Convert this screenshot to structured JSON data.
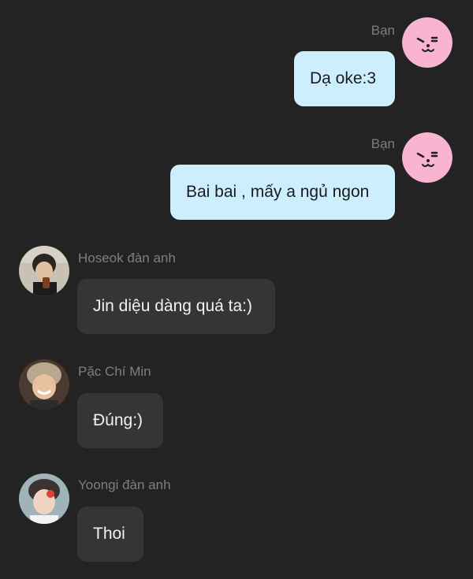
{
  "messages": [
    {
      "sender": "Bạn",
      "text": "Dạ oke:3",
      "avatar_icon": "bt21-pink-face-icon"
    },
    {
      "sender": "Bạn",
      "text": "Bai bai , mấy a ngủ ngon",
      "avatar_icon": "bt21-pink-face-icon"
    },
    {
      "sender": "Hoseok đàn anh",
      "text": "Jin diệu dàng quá ta:)",
      "avatar_icon": "person-photo-icon"
    },
    {
      "sender": "Pặc Chí Min",
      "text": "Đúng:)",
      "avatar_icon": "person-photo-icon"
    },
    {
      "sender": "Yoongi đàn anh",
      "text": "Thoi",
      "avatar_icon": "person-photo-icon"
    }
  ],
  "colors": {
    "background": "#232323",
    "my_bubble": "#cdeffd",
    "their_bubble": "#353535",
    "sender_name": "#7e7e7e",
    "avatar_pink": "#f8b4d0"
  }
}
